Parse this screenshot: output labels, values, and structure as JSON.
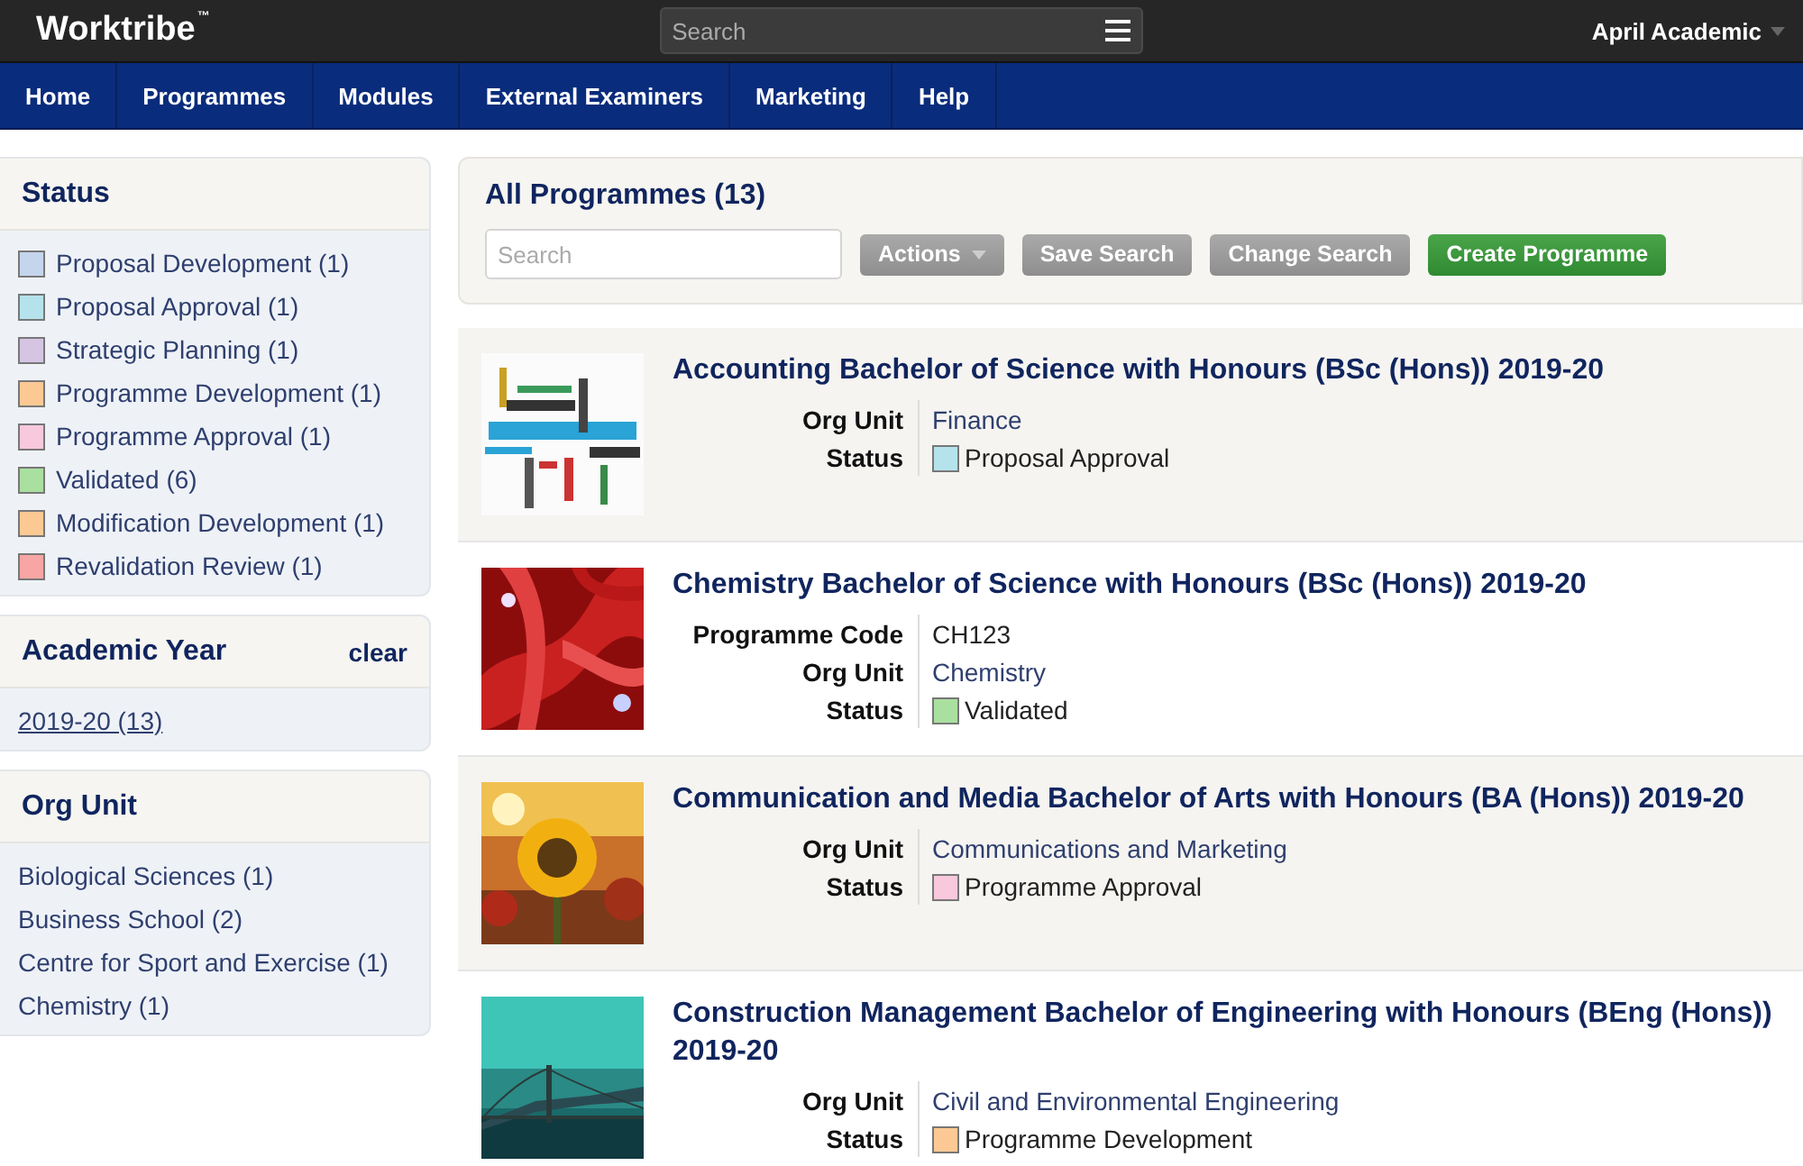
{
  "header": {
    "logo": "Worktribe",
    "logo_mark": "™",
    "search": {
      "placeholder": "Search"
    },
    "user": "April Academic"
  },
  "nav": [
    {
      "label": "Home"
    },
    {
      "label": "Programmes"
    },
    {
      "label": "Modules"
    },
    {
      "label": "External Examiners"
    },
    {
      "label": "Marketing"
    },
    {
      "label": "Help"
    }
  ],
  "sidebar": [
    {
      "title": "Status",
      "kind": "swatches",
      "items": [
        {
          "label": "Proposal Development (1)",
          "color": "#c5d5ee"
        },
        {
          "label": "Proposal Approval (1)",
          "color": "#b5e3ec"
        },
        {
          "label": "Strategic Planning (1)",
          "color": "#d5c5e3"
        },
        {
          "label": "Programme Development (1)",
          "color": "#fcc994"
        },
        {
          "label": "Programme Approval (1)",
          "color": "#f8c8dc"
        },
        {
          "label": "Validated (6)",
          "color": "#a9e0a0"
        },
        {
          "label": "Modification Development (1)",
          "color": "#fcc994"
        },
        {
          "label": "Revalidation Review (1)",
          "color": "#f7a5a5"
        }
      ]
    },
    {
      "title": "Academic Year",
      "action": "clear",
      "kind": "links",
      "items": [
        {
          "label": "2019-20 (13)"
        }
      ]
    },
    {
      "title": "Org Unit",
      "kind": "plain",
      "items": [
        {
          "label": "Biological Sciences (1)"
        },
        {
          "label": "Business School (2)"
        },
        {
          "label": "Centre for Sport and Exercise (1)"
        },
        {
          "label": "Chemistry (1)"
        }
      ]
    }
  ],
  "main": {
    "title": "All Programmes (13)",
    "search": {
      "placeholder": "Search"
    },
    "buttons": [
      {
        "label": "Actions",
        "kind": "dropdown"
      },
      {
        "label": "Save Search",
        "kind": "grey"
      },
      {
        "label": "Change Search",
        "kind": "grey"
      },
      {
        "label": "Create Programme",
        "kind": "primary"
      }
    ],
    "programmes": [
      {
        "title": "Accounting Bachelor of Science with Honours (BSc (Hons)) 2019-20",
        "kind": "picture",
        "fields": [
          {
            "label": "Org Unit",
            "value": "Finance",
            "kind": "link"
          },
          {
            "label": "Status",
            "value": "Proposal Approval",
            "kind": "status",
            "color": "#b5e3ec"
          }
        ]
      },
      {
        "title": "Chemistry Bachelor of Science with Honours (BSc (Hons)) 2019-20",
        "kind": "picture",
        "fields": [
          {
            "label": "Programme Code",
            "value": "CH123",
            "kind": "text"
          },
          {
            "label": "Org Unit",
            "value": "Chemistry",
            "kind": "link"
          },
          {
            "label": "Status",
            "value": "Validated",
            "kind": "status",
            "color": "#a9e0a0"
          }
        ]
      },
      {
        "title": "Communication and Media Bachelor of Arts with Honours (BA (Hons)) 2019-20",
        "kind": "picture",
        "fields": [
          {
            "label": "Org Unit",
            "value": "Communications and Marketing",
            "kind": "link"
          },
          {
            "label": "Status",
            "value": "Programme Approval",
            "kind": "status",
            "color": "#f8c8dc"
          }
        ]
      },
      {
        "title": "Construction Management Bachelor of Engineering with Honours (BEng (Hons)) 2019-20",
        "kind": "picture",
        "fields": [
          {
            "label": "Org Unit",
            "value": "Civil and Environmental Engineering",
            "kind": "link"
          },
          {
            "label": "Status",
            "value": "Programme Development",
            "kind": "status",
            "color": "#fcc994"
          }
        ]
      }
    ]
  }
}
